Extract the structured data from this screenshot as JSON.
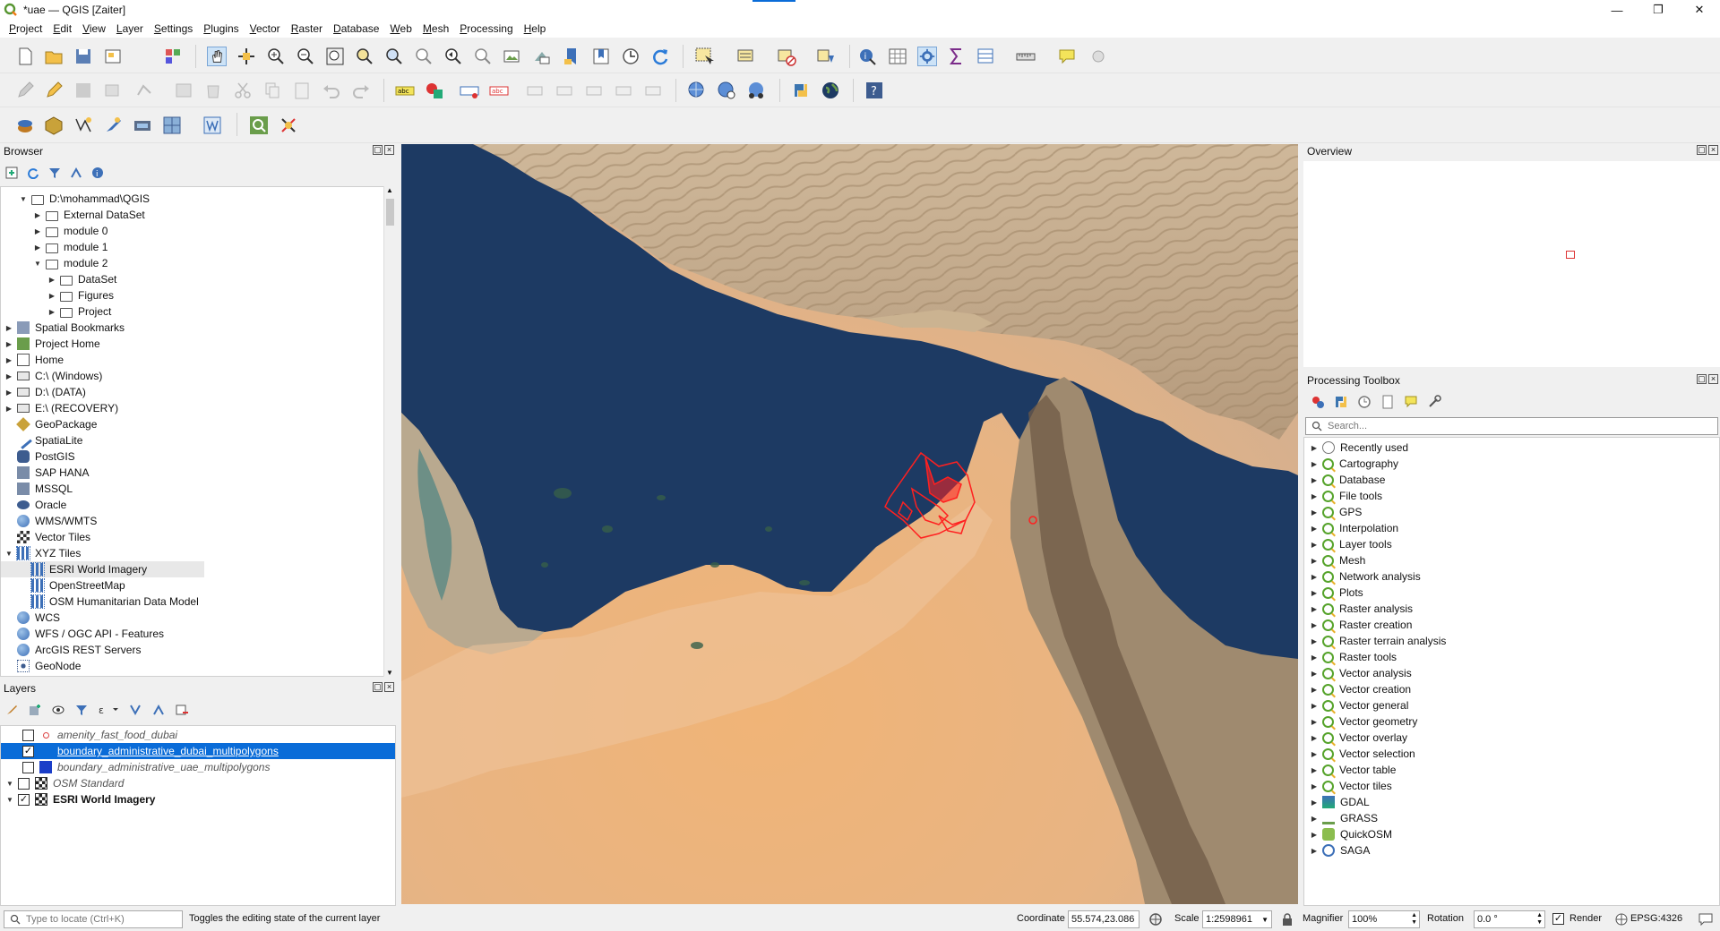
{
  "window": {
    "title": "*uae — QGIS [Zaiter]",
    "controls": [
      "minimize-icon",
      "restore-icon",
      "close-icon"
    ]
  },
  "menu": [
    "Project",
    "Edit",
    "View",
    "Layer",
    "Settings",
    "Plugins",
    "Vector",
    "Raster",
    "Database",
    "Web",
    "Mesh",
    "Processing",
    "Help"
  ],
  "browser": {
    "title": "Browser",
    "items": [
      {
        "label": "D:\\mohammad\\QGIS",
        "icon": "folder-icon",
        "expanded": true
      },
      {
        "label": "External DataSet",
        "icon": "folder-icon"
      },
      {
        "label": "module 0",
        "icon": "folder-icon"
      },
      {
        "label": "module 1",
        "icon": "folder-icon"
      },
      {
        "label": "module 2",
        "icon": "folder-icon",
        "expanded": true
      },
      {
        "label": "DataSet",
        "icon": "folder-icon"
      },
      {
        "label": "Figures",
        "icon": "folder-icon"
      },
      {
        "label": "Project",
        "icon": "folder-icon"
      },
      {
        "label": "Spatial Bookmarks",
        "icon": "bookmark-icon"
      },
      {
        "label": "Project Home",
        "icon": "project-home-icon"
      },
      {
        "label": "Home",
        "icon": "home-icon"
      },
      {
        "label": "C:\\ (Windows)",
        "icon": "drive-icon"
      },
      {
        "label": "D:\\ (DATA)",
        "icon": "drive-icon"
      },
      {
        "label": "E:\\ (RECOVERY)",
        "icon": "drive-icon"
      },
      {
        "label": "GeoPackage",
        "icon": "geopackage-icon"
      },
      {
        "label": "SpatiaLite",
        "icon": "spatialite-icon"
      },
      {
        "label": "PostGIS",
        "icon": "postgis-icon"
      },
      {
        "label": "SAP HANA",
        "icon": "sap-hana-icon"
      },
      {
        "label": "MSSQL",
        "icon": "mssql-icon"
      },
      {
        "label": "Oracle",
        "icon": "oracle-icon"
      },
      {
        "label": "WMS/WMTS",
        "icon": "wms-icon"
      },
      {
        "label": "Vector Tiles",
        "icon": "vector-tiles-icon"
      },
      {
        "label": "XYZ Tiles",
        "icon": "xyz-tiles-icon",
        "expanded": true
      },
      {
        "label": "ESRI World Imagery",
        "icon": "xyz-tile-icon",
        "selected": true
      },
      {
        "label": "OpenStreetMap",
        "icon": "xyz-tile-icon"
      },
      {
        "label": "OSM Humanitarian Data Model",
        "icon": "xyz-tile-icon"
      },
      {
        "label": "WCS",
        "icon": "wcs-icon"
      },
      {
        "label": "WFS / OGC API - Features",
        "icon": "wfs-icon"
      },
      {
        "label": "ArcGIS REST Servers",
        "icon": "arcgis-icon"
      },
      {
        "label": "GeoNode",
        "icon": "geonode-icon"
      }
    ]
  },
  "layers": {
    "title": "Layers",
    "items": [
      {
        "label": "amenity_fast_food_dubai",
        "checked": false,
        "style": "italic"
      },
      {
        "label": "boundary_administrative_dubai_multipolygons",
        "checked": true,
        "selected": true
      },
      {
        "label": "boundary_administrative_uae_multipolygons",
        "checked": false,
        "style": "italic"
      },
      {
        "label": "OSM Standard",
        "checked": false,
        "style": "italic"
      },
      {
        "label": "ESRI World Imagery",
        "checked": true,
        "style": "bold"
      }
    ]
  },
  "overview": {
    "title": "Overview"
  },
  "processing": {
    "title": "Processing Toolbox",
    "search_placeholder": "Search...",
    "items": [
      "Recently used",
      "Cartography",
      "Database",
      "File tools",
      "GPS",
      "Interpolation",
      "Layer tools",
      "Mesh",
      "Network analysis",
      "Plots",
      "Raster analysis",
      "Raster creation",
      "Raster terrain analysis",
      "Raster tools",
      "Vector analysis",
      "Vector creation",
      "Vector general",
      "Vector geometry",
      "Vector overlay",
      "Vector selection",
      "Vector table",
      "Vector tiles",
      "GDAL",
      "GRASS",
      "QuickOSM",
      "SAGA"
    ]
  },
  "status": {
    "locate_placeholder": "Type to locate (Ctrl+K)",
    "message": "Toggles the editing state of the current layer",
    "coordinate_label": "Coordinate",
    "coordinate": "55.574,23.086",
    "scale_label": "Scale",
    "scale": "1:2598961",
    "magnifier_label": "Magnifier",
    "magnifier": "100%",
    "rotation_label": "Rotation",
    "rotation": "0.0 °",
    "render_label": "Render",
    "crs": "EPSG:4326"
  },
  "colors": {
    "selection": "#0a6cd8",
    "sea": "#1d3a63",
    "desert": "#e8b07a",
    "mountain": "#c9a883",
    "boundary": "#ff2020"
  }
}
